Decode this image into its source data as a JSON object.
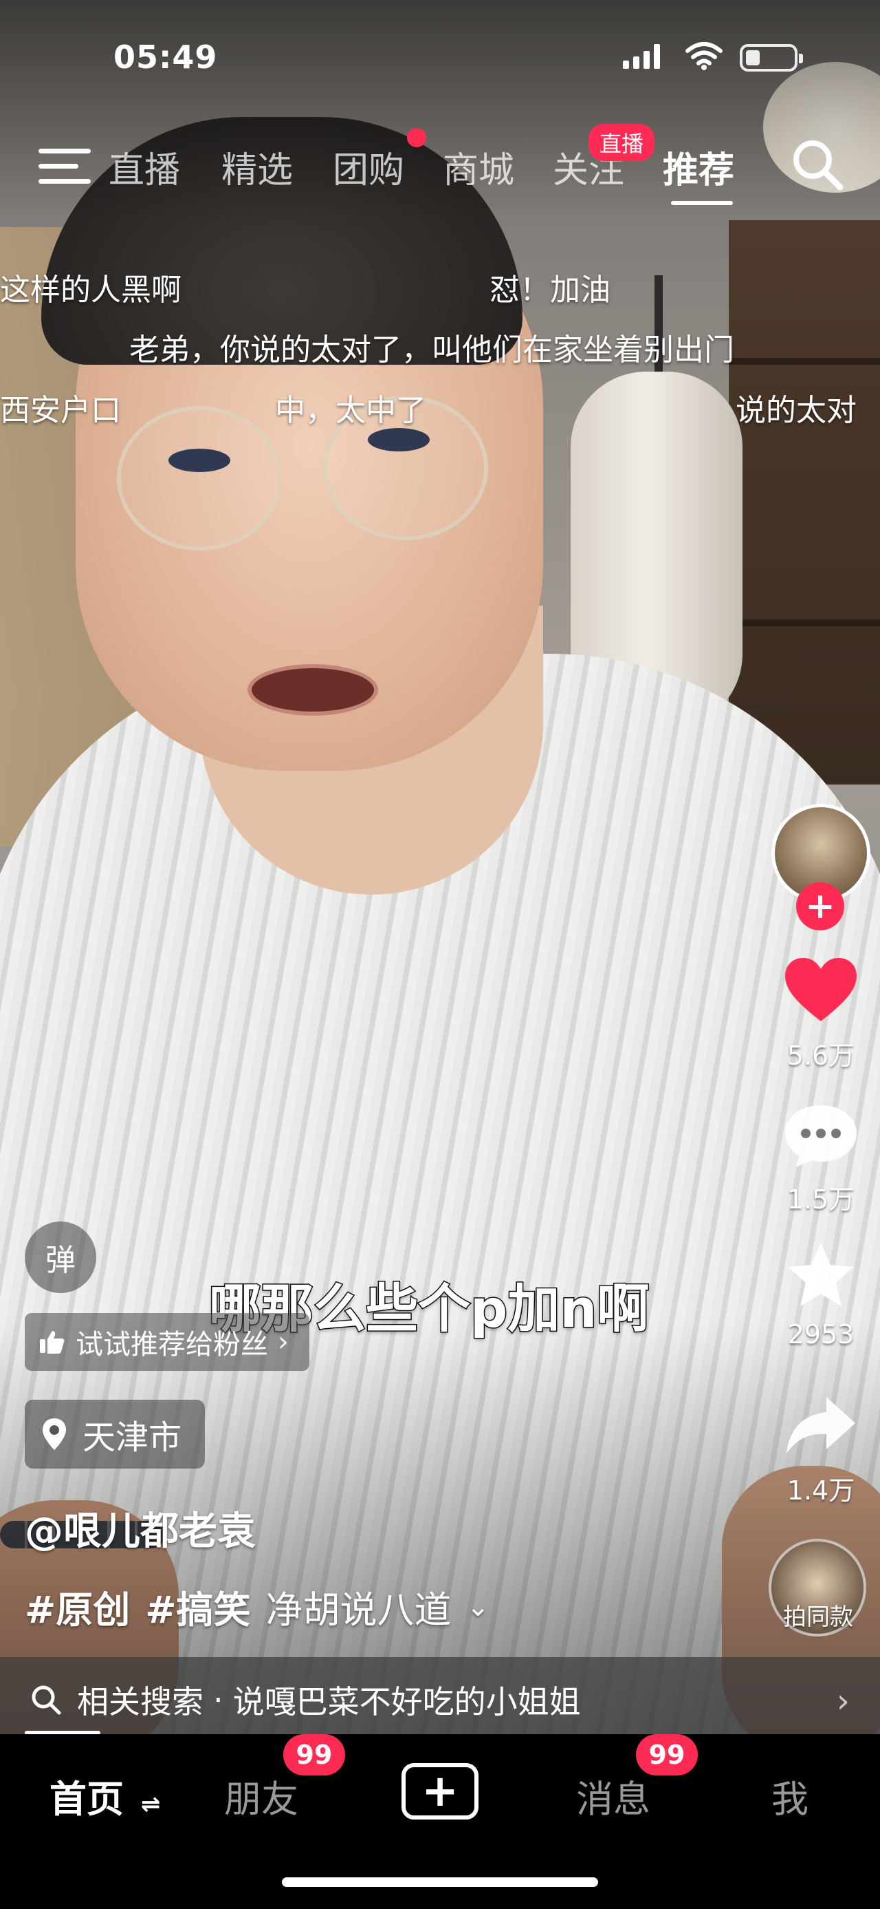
{
  "status_bar": {
    "time": "05:49"
  },
  "top_tabs": {
    "items": [
      {
        "label": "直播"
      },
      {
        "label": "精选"
      },
      {
        "label": "团购"
      },
      {
        "label": "商城"
      },
      {
        "label": "关注",
        "badge": "直播"
      },
      {
        "label": "推荐",
        "active": true
      }
    ]
  },
  "danmaku": [
    "这样的人黑啊",
    "怼！加油",
    "老弟，你说的太对了，叫他们在家坐着别出门",
    "西安户口",
    "中，太中了",
    "说的太对"
  ],
  "subtitle": "哪那么些个p加n啊",
  "actions": {
    "like_count": "5.6万",
    "comment_count": "1.5万",
    "favorite_count": "2953",
    "share_count": "1.4万",
    "collab_label": "拍同款"
  },
  "overlay": {
    "danmu_toggle": "弹",
    "recommend_chip": "试试推荐给粉丝",
    "location": "天津市",
    "author": "@哏儿都老袁",
    "tags": [
      "#原创",
      "#搞笑"
    ],
    "caption_text": "净胡说八道"
  },
  "related_search": {
    "prefix": "相关搜索",
    "separator": "·",
    "query": "说嘎巴菜不好吃的小姐姐"
  },
  "bottom_nav": {
    "home": "首页",
    "friends": "朋友",
    "friends_badge": "99",
    "messages": "消息",
    "messages_badge": "99",
    "me": "我"
  },
  "colors": {
    "accent": "#fe2c55",
    "like": "#fe2c55"
  }
}
